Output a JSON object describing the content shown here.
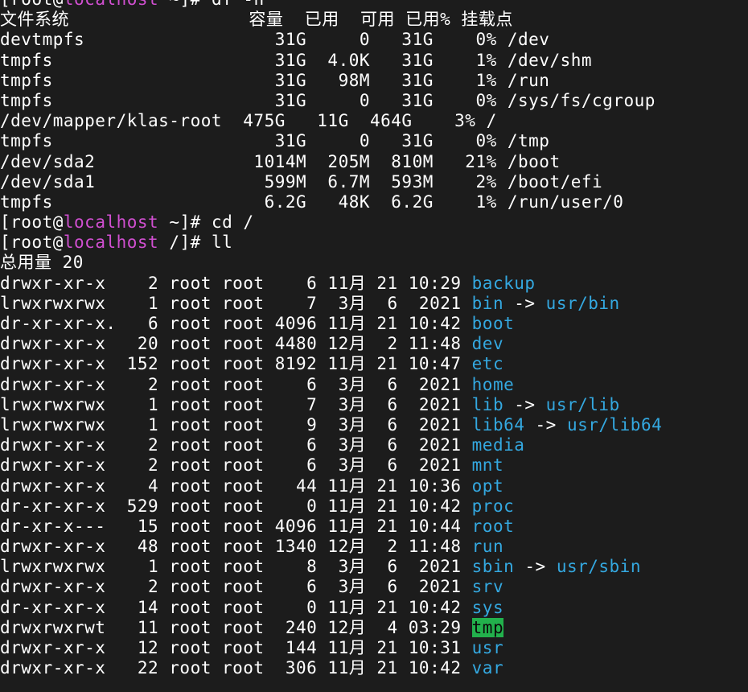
{
  "colors": {
    "background": "#1c1c1c",
    "foreground": "#ffffff",
    "hostname": "#d04fd0",
    "directory": "#34a8e0",
    "sticky_dir_bg": "#22b14c"
  },
  "terminal": {
    "lines": [
      {
        "type": "prompt",
        "user": "root",
        "host": "localhost",
        "cwd": "~",
        "cmd": "df -h"
      },
      {
        "type": "text",
        "text": "文件系统                 容量  已用  可用 已用% 挂载点"
      },
      {
        "type": "text",
        "text": "devtmpfs                  31G     0   31G    0% /dev"
      },
      {
        "type": "text",
        "text": "tmpfs                     31G  4.0K   31G    1% /dev/shm"
      },
      {
        "type": "text",
        "text": "tmpfs                     31G   98M   31G    1% /run"
      },
      {
        "type": "text",
        "text": "tmpfs                     31G     0   31G    0% /sys/fs/cgroup"
      },
      {
        "type": "text",
        "text": "/dev/mapper/klas-root  475G   11G  464G    3% /"
      },
      {
        "type": "text",
        "text": "tmpfs                     31G     0   31G    0% /tmp"
      },
      {
        "type": "text",
        "text": "/dev/sda2               1014M  205M  810M   21% /boot"
      },
      {
        "type": "text",
        "text": "/dev/sda1                599M  6.7M  593M    2% /boot/efi"
      },
      {
        "type": "text",
        "text": "tmpfs                    6.2G   48K  6.2G    1% /run/user/0"
      },
      {
        "type": "prompt",
        "user": "root",
        "host": "localhost",
        "cwd": "~",
        "cmd": "cd /"
      },
      {
        "type": "prompt",
        "user": "root",
        "host": "localhost",
        "cwd": "/",
        "cmd": "ll"
      },
      {
        "type": "text",
        "text": "总用量 20"
      },
      {
        "type": "entry",
        "meta": "drwxr-xr-x    2 root root    6 11月 21 10:29 ",
        "name": "backup",
        "style": "dir"
      },
      {
        "type": "entry",
        "meta": "lrwxrwxrwx    1 root root    7  3月  6  2021 ",
        "name": "bin",
        "link": "usr/bin",
        "style": "link"
      },
      {
        "type": "entry",
        "meta": "dr-xr-xr-x.   6 root root 4096 11月 21 10:42 ",
        "name": "boot",
        "style": "dir"
      },
      {
        "type": "entry",
        "meta": "drwxr-xr-x   20 root root 4480 12月  2 11:48 ",
        "name": "dev",
        "style": "dir"
      },
      {
        "type": "entry",
        "meta": "drwxr-xr-x  152 root root 8192 11月 21 10:47 ",
        "name": "etc",
        "style": "dir"
      },
      {
        "type": "entry",
        "meta": "drwxr-xr-x    2 root root    6  3月  6  2021 ",
        "name": "home",
        "style": "dir"
      },
      {
        "type": "entry",
        "meta": "lrwxrwxrwx    1 root root    7  3月  6  2021 ",
        "name": "lib",
        "link": "usr/lib",
        "style": "link"
      },
      {
        "type": "entry",
        "meta": "lrwxrwxrwx    1 root root    9  3月  6  2021 ",
        "name": "lib64",
        "link": "usr/lib64",
        "style": "link"
      },
      {
        "type": "entry",
        "meta": "drwxr-xr-x    2 root root    6  3月  6  2021 ",
        "name": "media",
        "style": "dir"
      },
      {
        "type": "entry",
        "meta": "drwxr-xr-x    2 root root    6  3月  6  2021 ",
        "name": "mnt",
        "style": "dir"
      },
      {
        "type": "entry",
        "meta": "drwxr-xr-x    4 root root   44 11月 21 10:36 ",
        "name": "opt",
        "style": "dir"
      },
      {
        "type": "entry",
        "meta": "dr-xr-xr-x  529 root root    0 11月 21 10:42 ",
        "name": "proc",
        "style": "dir"
      },
      {
        "type": "entry",
        "meta": "dr-xr-x---   15 root root 4096 11月 21 10:44 ",
        "name": "root",
        "style": "dir"
      },
      {
        "type": "entry",
        "meta": "drwxr-xr-x   48 root root 1340 12月  2 11:48 ",
        "name": "run",
        "style": "dir"
      },
      {
        "type": "entry",
        "meta": "lrwxrwxrwx    1 root root    8  3月  6  2021 ",
        "name": "sbin",
        "link": "usr/sbin",
        "style": "link"
      },
      {
        "type": "entry",
        "meta": "drwxr-xr-x    2 root root    6  3月  6  2021 ",
        "name": "srv",
        "style": "dir"
      },
      {
        "type": "entry",
        "meta": "dr-xr-xr-x   14 root root    0 11月 21 10:42 ",
        "name": "sys",
        "style": "dir"
      },
      {
        "type": "entry",
        "meta": "drwxrwxrwt   11 root root  240 12月  4 03:29 ",
        "name": "tmp",
        "style": "sticky"
      },
      {
        "type": "entry",
        "meta": "drwxr-xr-x   12 root root  144 11月 21 10:31 ",
        "name": "usr",
        "style": "dir"
      },
      {
        "type": "entry",
        "meta": "drwxr-xr-x   22 root root  306 11月 21 10:42 ",
        "name": "var",
        "style": "dir"
      }
    ]
  }
}
